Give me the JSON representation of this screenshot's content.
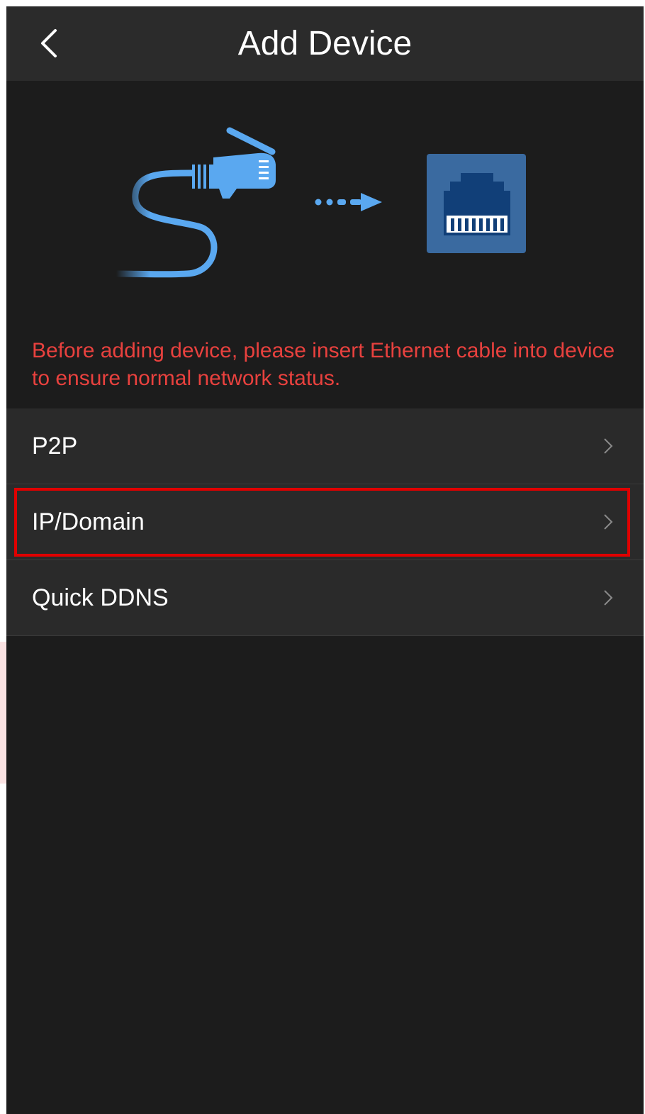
{
  "header": {
    "title": "Add Device",
    "back_icon": "chevron-left-icon"
  },
  "illustration": {
    "description_icons": [
      "ethernet-cable-icon",
      "dotted-arrow-icon",
      "ethernet-port-icon"
    ],
    "accent_color": "#5aa8f0",
    "port_color": "#3a6aa0"
  },
  "notice": {
    "text": "Before adding device, please insert Ethernet cable into device to ensure normal network status.",
    "color": "#e8413e"
  },
  "menu": {
    "items": [
      {
        "label": "P2P",
        "icon": "chevron-right-icon"
      },
      {
        "label": "IP/Domain",
        "icon": "chevron-right-icon",
        "highlighted": true
      },
      {
        "label": "Quick DDNS",
        "icon": "chevron-right-icon"
      }
    ]
  },
  "colors": {
    "background": "#1c1c1c",
    "header": "#2b2b2b",
    "row": "#2a2a2a",
    "highlight": "#e00000"
  }
}
